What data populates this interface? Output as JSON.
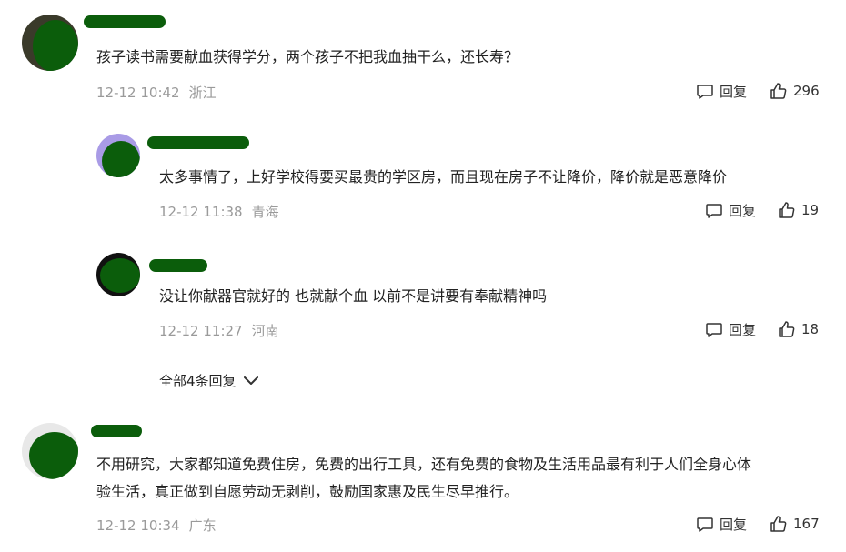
{
  "comments": [
    {
      "text": "孩子读书需要献血获得学分，两个孩子不把我血抽干么，还长寿？",
      "time": "12-12 10:42",
      "location": "浙江",
      "reply_label": "回复",
      "likes": "296"
    },
    {
      "text": "太多事情了，上好学校得要买最贵的学区房，而且现在房子不让降价，降价就是恶意降价",
      "time": "12-12 11:38",
      "location": "青海",
      "reply_label": "回复",
      "likes": "19"
    },
    {
      "text": "没让你献器官就好的 也就献个血 以前不是讲要有奉献精神吗",
      "time": "12-12 11:27",
      "location": "河南",
      "reply_label": "回复",
      "likes": "18"
    },
    {
      "text_line1": "不用研究，大家都知道免费住房，免费的出行工具，还有免费的食物及生活用品最有利于人们全身心体",
      "text_line2": "验生活，真正做到自愿劳动无剥削，鼓励国家惠及民生尽早推行。",
      "time": "12-12 10:34",
      "location": "广东",
      "reply_label": "回复",
      "likes": "167"
    }
  ],
  "more_replies": "全部4条回复",
  "colors": {
    "redaction": "#0b5d0b",
    "meta": "#9a9a9a"
  },
  "icons": [
    "comment-bubble-icon",
    "thumbs-up-icon",
    "chevron-down-icon"
  ]
}
